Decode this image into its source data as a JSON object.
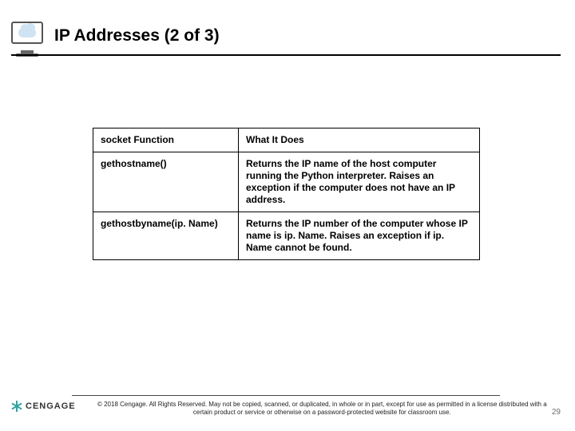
{
  "header": {
    "title": "IP Addresses (2 of 3)",
    "icon": "cloud-monitor-icon"
  },
  "table": {
    "headers": {
      "col1": "socket Function",
      "col2": "What It Does"
    },
    "rows": [
      {
        "fn": "gethostname()",
        "desc": "Returns the IP name of the host computer running the Python interpreter. Raises an exception if the computer does not have an IP address."
      },
      {
        "fn": "gethostbyname(ip. Name)",
        "desc": "Returns the IP number of the computer whose IP name is ip. Name. Raises an exception if ip. Name cannot be found."
      }
    ]
  },
  "footer": {
    "brand": "CENGAGE",
    "copyright": "© 2018 Cengage. All Rights Reserved. May not be copied, scanned, or duplicated, in whole or in part, except for use as permitted in a license distributed with a certain product or service or otherwise on a password-protected website for classroom use.",
    "page_number": "29"
  }
}
